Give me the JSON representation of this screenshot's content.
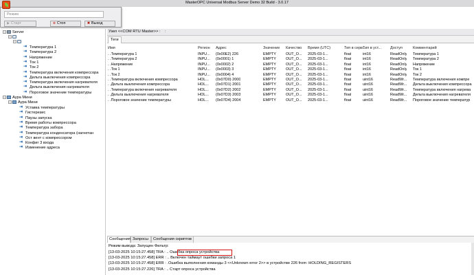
{
  "window": {
    "title": "MasterOPC Universal Modbus Server Demo 32 Build - 3.0.17"
  },
  "toolbar": {
    "mode_placeholder": "Режим",
    "start_label": "Старт",
    "stop_label": "Стоп",
    "exit_label": "Выход"
  },
  "tree": {
    "server_label": "Server",
    "node1_tags": [
      "Температура 1",
      "Температура 2",
      "Напряжение",
      "Ток 1",
      "Ток 2",
      "Температура включения компрессора",
      "Дельта выключения компрессора",
      "Температура включения нагревателя",
      "Дельта выключения нагревателя",
      "Пороговое значение температуры"
    ],
    "device_label": "Аура Мини",
    "subdevice_label": "Аура Мини",
    "device_tags": [
      "Уставка температуры",
      "Гистерезис",
      "Паузы запуска",
      "Время работы компрессора",
      "Температура забора",
      "Температура конденсатора (нагнетан",
      "Ост вент с компрессором",
      "Конфиг 3 входа",
      "Изменение адреса"
    ]
  },
  "node_header": {
    "label": "Узел <<COM RTU Master>> :",
    "close": ":"
  },
  "tags_tab": {
    "label": "Теги"
  },
  "table": {
    "headers": [
      "Имя",
      "Регион",
      "Адрес",
      "Значение",
      "Качество",
      "Время (UTC)",
      "Тип в серв...",
      "Тип в уст...",
      "Доступ",
      "Комментарий"
    ],
    "rows": [
      [
        ". .Температура 1",
        "INPU...",
        "(0x00E2) 226",
        "EMPTY",
        "OUT_O...",
        "2025-03-1...",
        "float",
        "int16",
        "ReadOnly",
        "Температура 1"
      ],
      [
        ". .Температура 2",
        "INPU...",
        "(0x0001) 1",
        "EMPTY",
        "OUT_O...",
        "2025-03-1...",
        "float",
        "int16",
        "ReadOnly",
        "Температура 2"
      ],
      [
        ". .Напряжение",
        "INPU...",
        "(0x0002) 2",
        "EMPTY",
        "OUT_O...",
        "2025-03-1...",
        "float",
        "int16",
        "ReadOnly",
        "Напряжение"
      ],
      [
        ". .Ток 1",
        "INPU...",
        "(0x0003) 3",
        "EMPTY",
        "OUT_O...",
        "2025-03-1...",
        "float",
        "int16",
        "ReadOnly",
        "Ток 1"
      ],
      [
        ". .Ток 2",
        "INPU...",
        "(0x0004) 4",
        "EMPTY",
        "OUT_O...",
        "2025-03-1...",
        "float",
        "int16",
        "ReadOnly",
        "Ток 2"
      ],
      [
        ". .Температура включения компрессора",
        "HOL...",
        "(0x07D0) 2000",
        "EMPTY",
        "OUT_O...",
        "2025-03-1...",
        "float",
        "uint16",
        "ReadWr...",
        "Температура включения компре"
      ],
      [
        ". .Дельта выключения компрессора",
        "HOL...",
        "(0x07D1) 2001",
        "EMPTY",
        "OUT_O...",
        "2025-03-1...",
        "float",
        "uint16",
        "ReadWr...",
        "Дельта выключения компрессора"
      ],
      [
        ". .Температура включения нагревателя",
        "HOL...",
        "(0x07D2) 2002",
        "EMPTY",
        "OUT_O...",
        "2025-03-1...",
        "float",
        "uint16",
        "ReadWr...",
        "Температура включения нагрева"
      ],
      [
        ". .Дельта выключения нагревателя",
        "HOL...",
        "(0x07D3) 2003",
        "EMPTY",
        "OUT_O...",
        "2025-03-1...",
        "float",
        "uint16",
        "ReadWr...",
        "Дельта выключения нагревателя"
      ],
      [
        ". .Пороговое значение температуры",
        "HOL...",
        "(0x07D4) 2004",
        "EMPTY",
        "OUT_O...",
        "2025-03-1...",
        "float",
        "uint16",
        "ReadWr...",
        "Пороговое значение температур"
      ]
    ]
  },
  "messages": {
    "tabs": [
      "Сообщения",
      "Запросы",
      "Сообщения скриптов"
    ],
    "filter_line": "Режим вывода: Запущен Фильтр:",
    "log": [
      "[13-03-2025 10:15:27.458] TRA : .. Ошибка опроса устройства",
      "[13-03-2025 10:15:27.458] ERR : .. Включен таймаут ошибки запроса 1",
      "[13-03-2025 10:15:27.458] ERR : .Ошибка выполнения команды 3 <<Unknown error 2>> в устройстве 226 from :HOLDING_REGISTERS",
      "[13-03-2025 10:15:27.226] TRA : .. Старт опроса устройства"
    ]
  },
  "colors": {
    "highlight_border": "#d21010",
    "logo": "#e84c1a"
  }
}
